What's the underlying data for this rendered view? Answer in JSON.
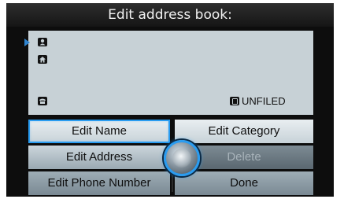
{
  "title": "Edit address book:",
  "info_panel": {
    "icons": [
      "person-icon",
      "home-icon",
      "phone-icon"
    ],
    "category_label": "UNFILED",
    "category_icon": "category-tag-icon"
  },
  "menu": {
    "edit_name": "Edit Name",
    "edit_category": "Edit Category",
    "edit_address": "Edit Address",
    "delete": "Delete",
    "edit_phone": "Edit Phone Number",
    "done": "Done"
  },
  "colors": {
    "accent": "#2a9cf0",
    "panel": "#c7d1d6",
    "background": "#0d0d0d"
  }
}
